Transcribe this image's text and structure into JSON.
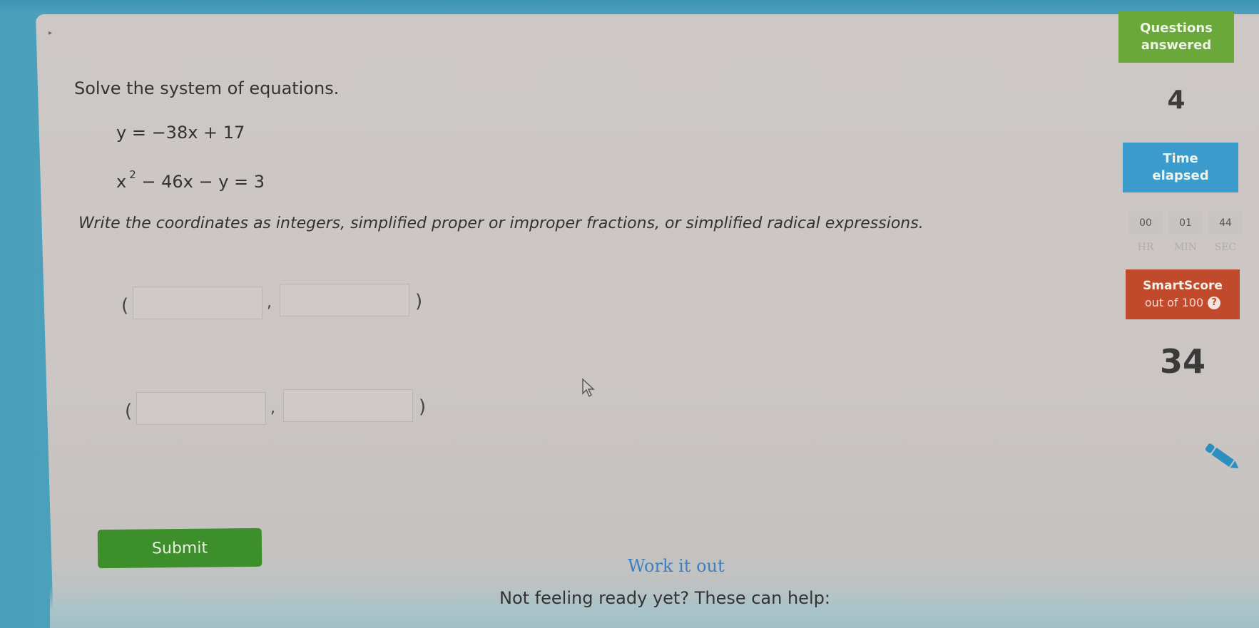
{
  "question": {
    "title": "Solve the system of equations.",
    "equations": [
      {
        "text": "y = −38x + 17"
      },
      {
        "base": "x",
        "exponent": "2",
        "rest": " − 46x − y = 3"
      }
    ],
    "instructions": "Write the coordinates as integers, simplified proper or improper fractions, or simplified radical expressions."
  },
  "answers": {
    "open_paren": "(",
    "comma": ",",
    "close_paren": ")",
    "rows": [
      {
        "x_value": "",
        "y_value": ""
      },
      {
        "x_value": "",
        "y_value": ""
      }
    ]
  },
  "actions": {
    "submit_label": "Submit",
    "work_it_out_label": "Work it out",
    "not_ready_text": "Not feeling ready yet? These can help:"
  },
  "sidebar": {
    "questions_answered": {
      "label_line1": "Questions",
      "label_line2": "answered",
      "value": "4",
      "color": "#6aa83a"
    },
    "time_elapsed": {
      "label_line1": "Time",
      "label_line2": "elapsed",
      "color": "#3a9bcc",
      "hours": "00",
      "minutes": "01",
      "seconds": "44",
      "hours_unit": "HR",
      "minutes_unit": "MIN",
      "seconds_unit": "SEC"
    },
    "smartscore": {
      "label": "SmartScore",
      "sublabel": "out of 100",
      "help_icon": "?",
      "value": "34",
      "color": "#c24a2c"
    }
  },
  "icons": {
    "cursor": "arrow-cursor-icon",
    "pencil": "pencil-icon",
    "help": "question-circle-icon"
  }
}
